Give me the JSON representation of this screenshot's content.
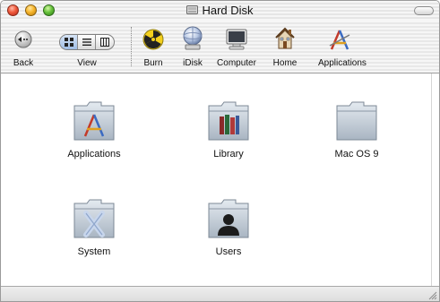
{
  "window": {
    "title": "Hard Disk",
    "title_icon": "hard-disk-icon"
  },
  "toolbar": {
    "back_label": "Back",
    "view_label": "View",
    "view_modes": [
      "icon-view",
      "list-view",
      "column-view"
    ],
    "view_selected": "icon-view",
    "places": [
      {
        "label": "Burn",
        "icon": "burn-icon"
      },
      {
        "label": "iDisk",
        "icon": "idisk-icon"
      },
      {
        "label": "Computer",
        "icon": "computer-icon"
      },
      {
        "label": "Home",
        "icon": "home-icon"
      },
      {
        "label": "Applications",
        "icon": "applications-icon"
      }
    ]
  },
  "items": [
    {
      "label": "Applications",
      "icon": "applications-folder-icon"
    },
    {
      "label": "Library",
      "icon": "library-folder-icon"
    },
    {
      "label": "Mac OS 9",
      "icon": "folder-icon"
    },
    {
      "label": "System",
      "icon": "system-folder-icon"
    },
    {
      "label": "Users",
      "icon": "users-folder-icon"
    }
  ],
  "colors": {
    "accent": "#4a86d8",
    "folder": "#bcc6d0"
  }
}
